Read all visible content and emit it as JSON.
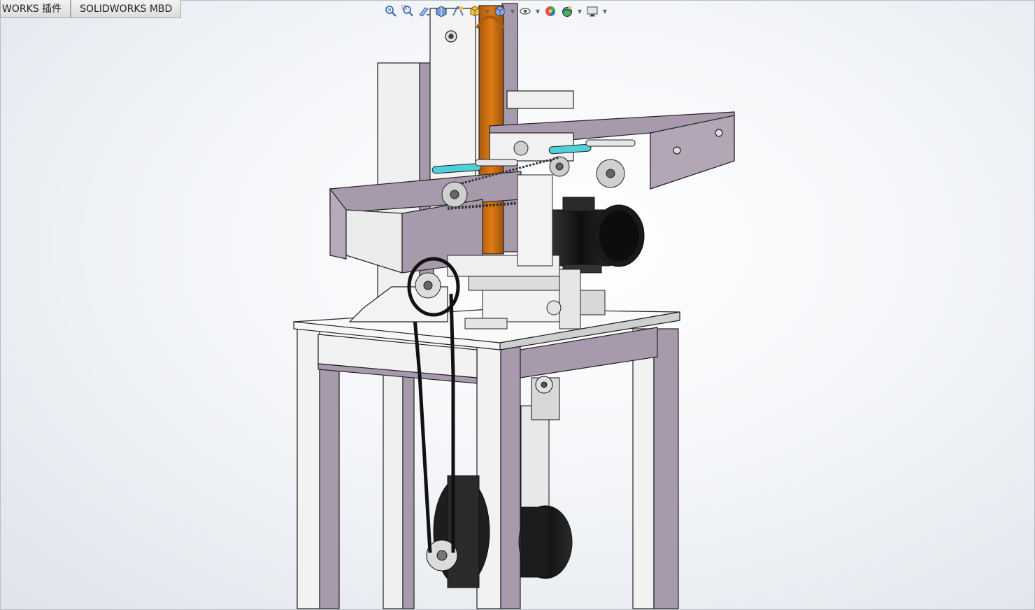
{
  "tabs": [
    {
      "label": "WORKS 插件"
    },
    {
      "label": "SOLIDWORKS MBD"
    }
  ],
  "heads_up_toolbar": [
    {
      "icon": "zoom-to-fit-icon"
    },
    {
      "icon": "zoom-to-area-icon"
    },
    {
      "icon": "previous-view-icon"
    },
    {
      "icon": "section-view-icon"
    },
    {
      "icon": "dynamic-annotation-icon"
    },
    {
      "icon": "view-orientation-icon"
    },
    {
      "icon": "display-style-icon"
    },
    {
      "icon": "hide-show-items-icon"
    },
    {
      "icon": "edit-appearance-icon"
    },
    {
      "icon": "apply-scene-icon"
    },
    {
      "icon": "view-settings-icon"
    }
  ],
  "colors": {
    "frame_purple": "#a89aad",
    "frame_light": "#f2f2f2",
    "belt_orange": "#e07a12",
    "motor_black": "#1a1a1a",
    "roller_cyan": "#4ed0d8",
    "tab_bg": "#e6e6e6"
  }
}
